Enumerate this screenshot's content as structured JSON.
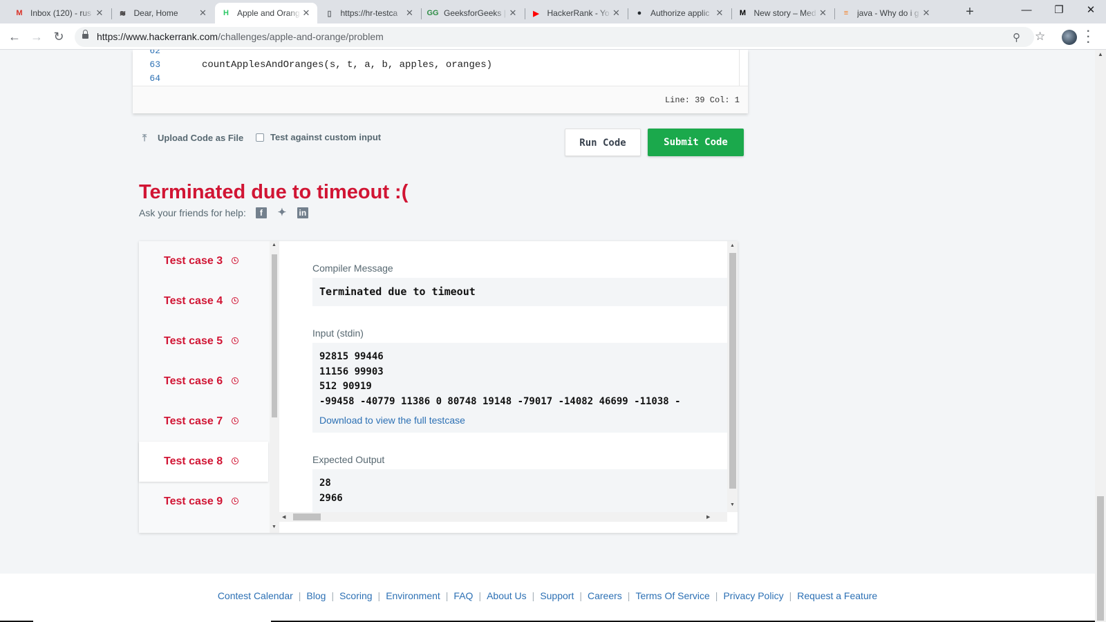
{
  "browser": {
    "tabs": [
      {
        "title": "Inbox (120) - rus",
        "icon": "gmail-icon",
        "icon_char": "M",
        "icon_color": "#d93025",
        "active": false
      },
      {
        "title": "Dear, Home",
        "icon": "spotify-icon",
        "icon_char": "≋",
        "icon_color": "#191414",
        "active": false
      },
      {
        "title": "Apple and Orang",
        "icon": "hackerrank-icon",
        "icon_char": "H",
        "icon_color": "#2ec866",
        "active": true
      },
      {
        "title": "https://hr-testca",
        "icon": "document-icon",
        "icon_char": "▯",
        "icon_color": "#5f6368",
        "active": false
      },
      {
        "title": "GeeksforGeeks |",
        "icon": "geeksforgeeks-icon",
        "icon_char": "GG",
        "icon_color": "#2f8d46",
        "active": false
      },
      {
        "title": "HackerRank - Yo",
        "icon": "youtube-icon",
        "icon_char": "▶",
        "icon_color": "#ff0000",
        "active": false
      },
      {
        "title": "Authorize applic",
        "icon": "github-icon",
        "icon_char": "●",
        "icon_color": "#24292e",
        "active": false
      },
      {
        "title": "New story – Med",
        "icon": "medium-icon",
        "icon_char": "M",
        "icon_color": "#000000",
        "active": false
      },
      {
        "title": "java - Why do i g",
        "icon": "stackoverflow-icon",
        "icon_char": "≡",
        "icon_color": "#f48024",
        "active": false
      }
    ],
    "url_host": "https://www.hackerrank.com",
    "url_path": "/challenges/apple-and-orange/problem"
  },
  "editor": {
    "lines": [
      {
        "num": "62",
        "code": ""
      },
      {
        "num": "63",
        "code": "countApplesAndOranges(s, t, a, b, apples, oranges)"
      },
      {
        "num": "64",
        "code": ""
      }
    ],
    "cursor": "Line: 39 Col: 1"
  },
  "actions": {
    "upload_label": "Upload Code as File",
    "custom_input_label": "Test against custom input",
    "run_label": "Run Code",
    "submit_label": "Submit Code"
  },
  "result": {
    "verdict": "Terminated due to timeout :(",
    "help_text": "Ask your friends for help:",
    "test_cases": [
      {
        "label": "Test case 3",
        "active": false
      },
      {
        "label": "Test case 4",
        "active": false
      },
      {
        "label": "Test case 5",
        "active": false
      },
      {
        "label": "Test case 6",
        "active": false
      },
      {
        "label": "Test case 7",
        "active": false
      },
      {
        "label": "Test case 8",
        "active": true
      },
      {
        "label": "Test case 9",
        "active": false
      }
    ],
    "compiler_label": "Compiler Message",
    "compiler_message": "Terminated due to timeout",
    "input_label": "Input (stdin)",
    "input_lines": "92815 99446\n11156 99903\n512 90919\n-99458 -40779 11386 0 80748 19148 -79017 -14082 46699 -11038 -",
    "download_link": "Download to view the full testcase",
    "expected_label": "Expected Output",
    "expected_lines": "28\n2966"
  },
  "footer": {
    "links": [
      "Contest Calendar",
      "Blog",
      "Scoring",
      "Environment",
      "FAQ",
      "About Us",
      "Support",
      "Careers",
      "Terms Of Service",
      "Privacy Policy",
      "Request a Feature"
    ]
  },
  "colors": {
    "accent_red": "#d11534",
    "submit_green": "#1ba94c",
    "link_blue": "#2c70b4"
  }
}
